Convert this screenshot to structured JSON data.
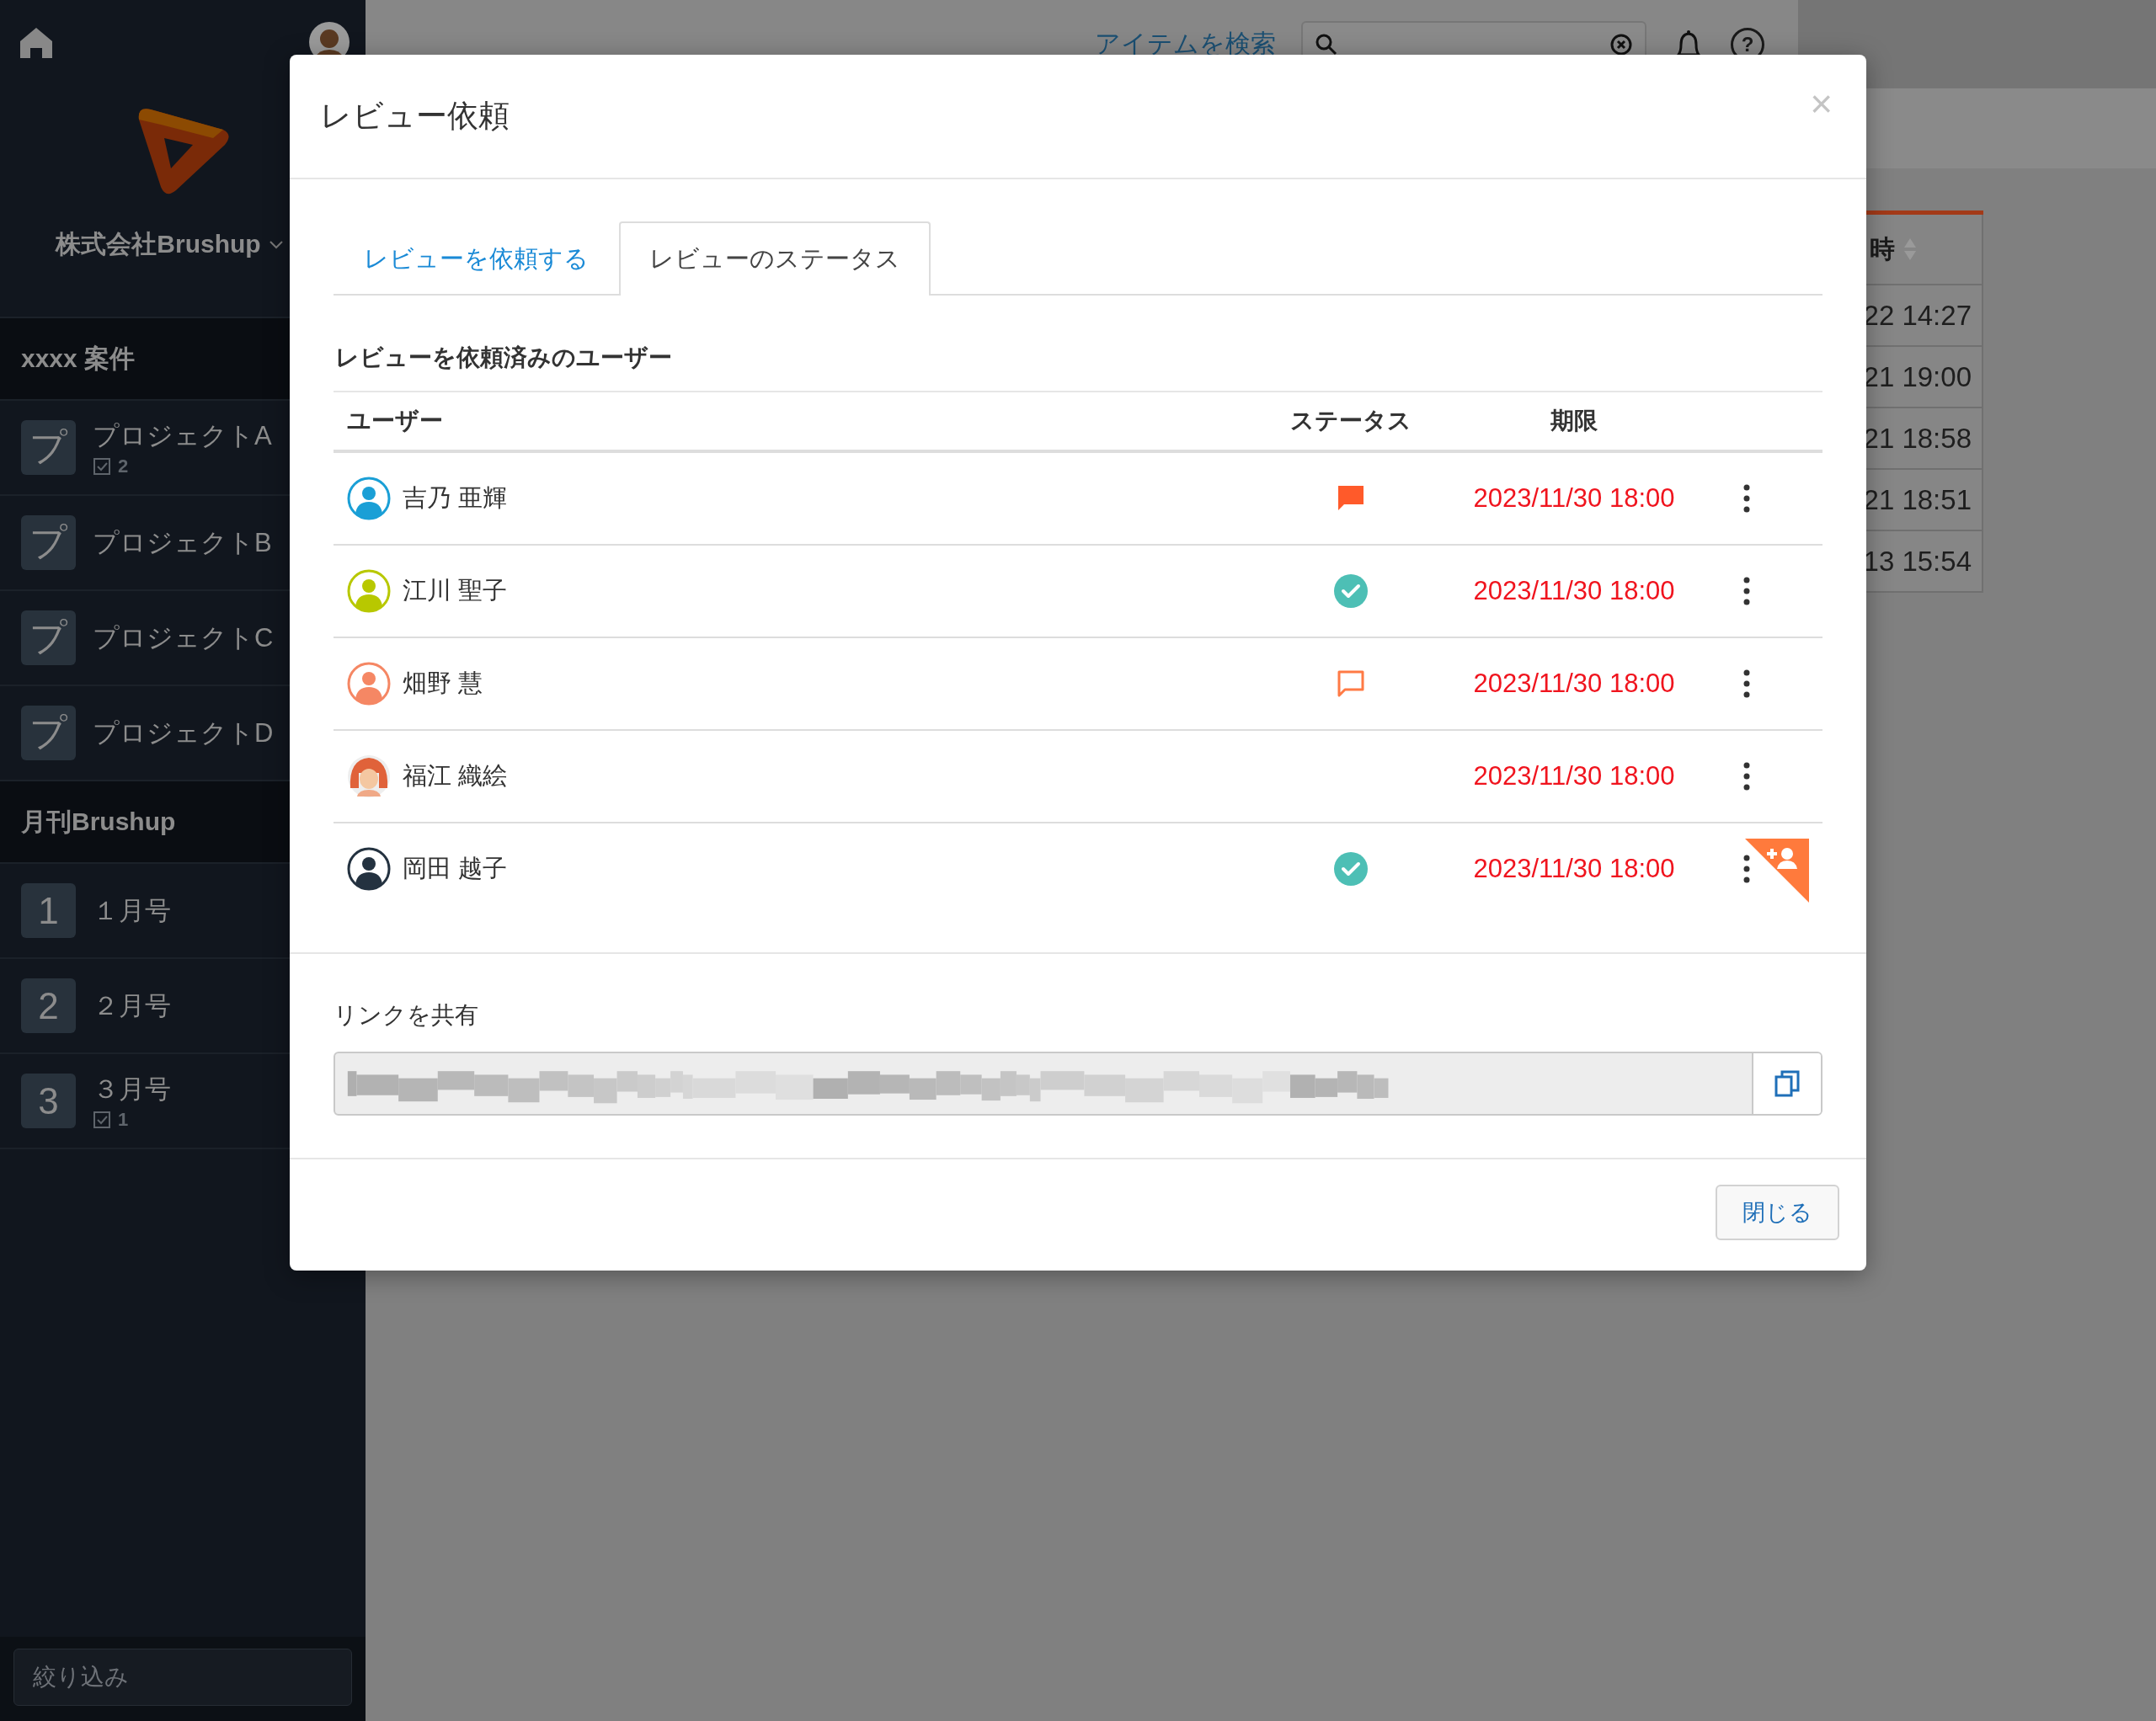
{
  "sidebar": {
    "company": "株式会社Brushup",
    "sections": [
      {
        "title": "xxxx 案件",
        "items": [
          {
            "tile": "プ",
            "label": "プロジェクトA",
            "count": "2"
          },
          {
            "tile": "プ",
            "label": "プロジェクトB"
          },
          {
            "tile": "プ",
            "label": "プロジェクトC"
          },
          {
            "tile": "プ",
            "label": "プロジェクトD"
          }
        ]
      },
      {
        "title": "月刊Brushup",
        "items": [
          {
            "tile": "1",
            "label": "１月号"
          },
          {
            "tile": "2",
            "label": "２月号"
          },
          {
            "tile": "3",
            "label": "３月号",
            "count": "1"
          }
        ]
      }
    ],
    "filter": {
      "placeholder": "絞り込み"
    }
  },
  "topbar": {
    "search_label": "アイテムを検索",
    "help": "?"
  },
  "background_table": {
    "header": "時",
    "rows": [
      "22 14:27",
      "21 19:00",
      "21 18:58",
      "21 18:51",
      "13 15:54"
    ]
  },
  "dialog": {
    "title": "レビュー依頼",
    "close": "×",
    "tabs": [
      {
        "label": "レビューを依頼する",
        "selected": false
      },
      {
        "label": "レビューのステータス",
        "selected": true
      }
    ],
    "section_title": "レビューを依頼済みのユーザー",
    "columns": [
      "ユーザー",
      "ステータス",
      "期限"
    ],
    "rows": [
      {
        "name": "吉乃 亜輝",
        "avatar": {
          "kind": "silhouette",
          "color": "#1a9fd6"
        },
        "status": {
          "kind": "comment_filled"
        },
        "deadline": "2023/11/30 18:00",
        "add_badge": false
      },
      {
        "name": "江川 聖子",
        "avatar": {
          "kind": "silhouette",
          "color": "#b8c800"
        },
        "status": {
          "kind": "approved"
        },
        "deadline": "2023/11/30 18:00",
        "add_badge": false
      },
      {
        "name": "畑野 慧",
        "avatar": {
          "kind": "silhouette",
          "color": "#f58764"
        },
        "status": {
          "kind": "comment_outline"
        },
        "deadline": "2023/11/30 18:00",
        "add_badge": false
      },
      {
        "name": "福江 織絵",
        "avatar": {
          "kind": "illustration",
          "color": "#e0623a"
        },
        "status": {
          "kind": "none"
        },
        "deadline": "2023/11/30 18:00",
        "add_badge": false
      },
      {
        "name": "岡田 越子",
        "avatar": {
          "kind": "silhouette",
          "color": "#243240"
        },
        "status": {
          "kind": "approved"
        },
        "deadline": "2023/11/30 18:00",
        "add_badge": true
      }
    ],
    "share": {
      "label": "リンクを共有"
    },
    "close_button": "閉じる"
  }
}
